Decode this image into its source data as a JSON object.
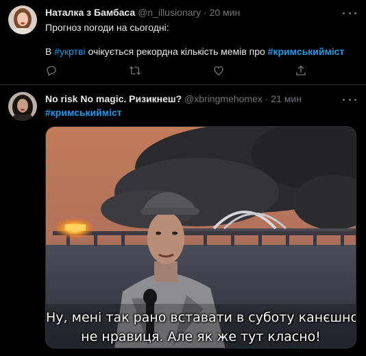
{
  "tweet1": {
    "display_name": "Наталка з Бамбаса",
    "handle": "@n_illusionary",
    "separator": "·",
    "time": "20 мин",
    "line1": "Прогноз погоди на сьогодні:",
    "line2_prefix": "В ",
    "hashtag1": "#укртві",
    "line2_middle": " очікується рекордна кількість мемів про ",
    "hashtag2": "#кримськийміст",
    "actions": [
      "reply-icon",
      "retweet-icon",
      "like-icon",
      "share-icon"
    ]
  },
  "tweet2": {
    "display_name": "No risk No magic. Ризикнеш?",
    "handle": "@xbringmehomex",
    "separator": "·",
    "time": "21 мин",
    "hashtag": "#кримськийміст",
    "caption_line1": "Ну, мені так рано вставати в суботу канєшно",
    "caption_line2": "не нравиця. Але як же тут класно!"
  },
  "colors": {
    "background": "#000000",
    "text": "#e7e9ea",
    "secondary": "#71767b",
    "link": "#1d9bf0",
    "divider": "#2f3336"
  }
}
